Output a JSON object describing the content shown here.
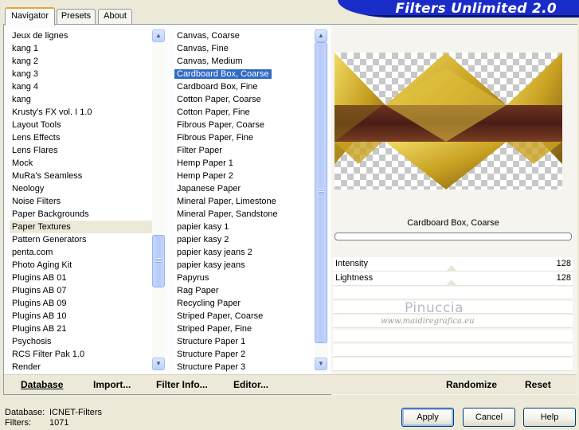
{
  "tabs": [
    "Navigator",
    "Presets",
    "About"
  ],
  "banner_title": "Filters Unlimited 2.0",
  "categories": [
    "Jeux de lignes",
    "kang 1",
    "kang 2",
    "kang 3",
    "kang 4",
    "kang",
    "Krusty's FX vol. I 1.0",
    "Layout Tools",
    "Lens Effects",
    "Lens Flares",
    "Mock",
    "MuRa's Seamless",
    "Neology",
    "Noise Filters",
    "Paper Backgrounds",
    "Paper Textures",
    "Pattern Generators",
    "penta.com",
    "Photo Aging Kit",
    "Plugins AB 01",
    "Plugins AB 07",
    "Plugins AB 09",
    "Plugins AB 10",
    "Plugins AB 21",
    "Psychosis",
    "RCS Filter Pak 1.0",
    "Render"
  ],
  "selected_category": "Paper Textures",
  "filters": [
    "Canvas, Coarse",
    "Canvas, Fine",
    "Canvas, Medium",
    "Cardboard Box, Coarse",
    "Cardboard Box, Fine",
    "Cotton Paper, Coarse",
    "Cotton Paper, Fine",
    "Fibrous Paper, Coarse",
    "Fibrous Paper, Fine",
    "Filter Paper",
    "Hemp Paper 1",
    "Hemp Paper 2",
    "Japanese Paper",
    "Mineral Paper, Limestone",
    "Mineral Paper, Sandstone",
    "papier kasy 1",
    "papier kasy 2",
    "papier kasy jeans 2",
    "papier kasy jeans",
    "Papyrus",
    "Rag Paper",
    "Recycling Paper",
    "Striped Paper, Coarse",
    "Striped Paper, Fine",
    "Structure Paper 1",
    "Structure Paper 2",
    "Structure Paper 3"
  ],
  "selected_filter": "Cardboard Box, Coarse",
  "preview": {
    "filter_name": "Cardboard Box, Coarse",
    "progress": 0
  },
  "params": [
    {
      "label": "Intensity",
      "value": "128"
    },
    {
      "label": "Lightness",
      "value": "128"
    }
  ],
  "watermark": {
    "name": "Pinuccia",
    "url": "www.maidiregrafica.eu"
  },
  "toolbar": {
    "database": "Database",
    "import": "Import...",
    "filter_info": "Filter Info...",
    "editor": "Editor...",
    "randomize": "Randomize",
    "reset": "Reset"
  },
  "status": {
    "database_label": "Database:",
    "database_value": "ICNET-Filters",
    "filters_label": "Filters:",
    "filters_value": "1071"
  },
  "buttons": {
    "apply": "Apply",
    "cancel": "Cancel",
    "help": "Help"
  },
  "colors": {
    "banner": "#1a2cc8",
    "selection": "#316ac5",
    "dialog_bg": "#ece9d8",
    "preview_gold": "#d8b82c",
    "preview_brown": "#5e2a1c"
  },
  "icons": {
    "scroll_up": "scroll-up-arrow-icon",
    "scroll_down": "scroll-down-arrow-icon"
  }
}
